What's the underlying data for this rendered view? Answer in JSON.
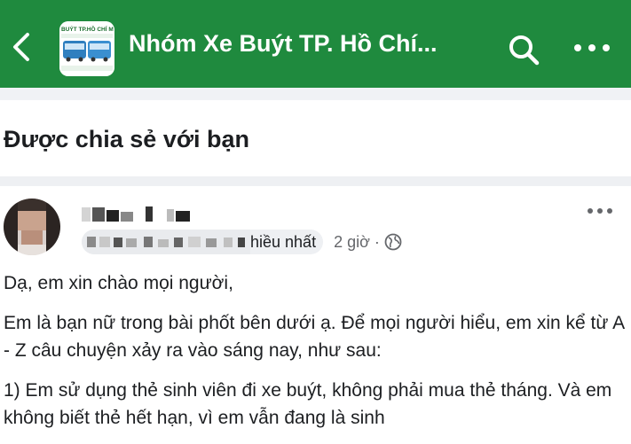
{
  "header": {
    "title": "Nhóm Xe Buýt TP. Hồ Chí...",
    "back_icon": "chevron-left-icon",
    "search_icon": "search-icon",
    "more_icon": "more-horizontal-icon",
    "bar_color": "#1f8a3e",
    "thumb_caption": "BUÝT TP.HỒ CHÍ M"
  },
  "section": {
    "title": "Được chia sẻ với bạn"
  },
  "post": {
    "meta_text": "hiều nhất",
    "time": "2 giờ",
    "separator": "·",
    "privacy_icon": "globe-icon",
    "paragraphs": [
      "Dạ, em xin chào mọi người,",
      "Em là bạn nữ trong bài phốt bên dưới ạ. Để mọi người hiểu, em xin kể từ A - Z câu chuyện xảy ra vào sáng nay, như sau:",
      "1) Em sử dụng thẻ sinh viên đi xe buýt, không phải mua thẻ tháng. Và em không biết thẻ hết hạn, vì em vẫn đang là sinh"
    ]
  }
}
